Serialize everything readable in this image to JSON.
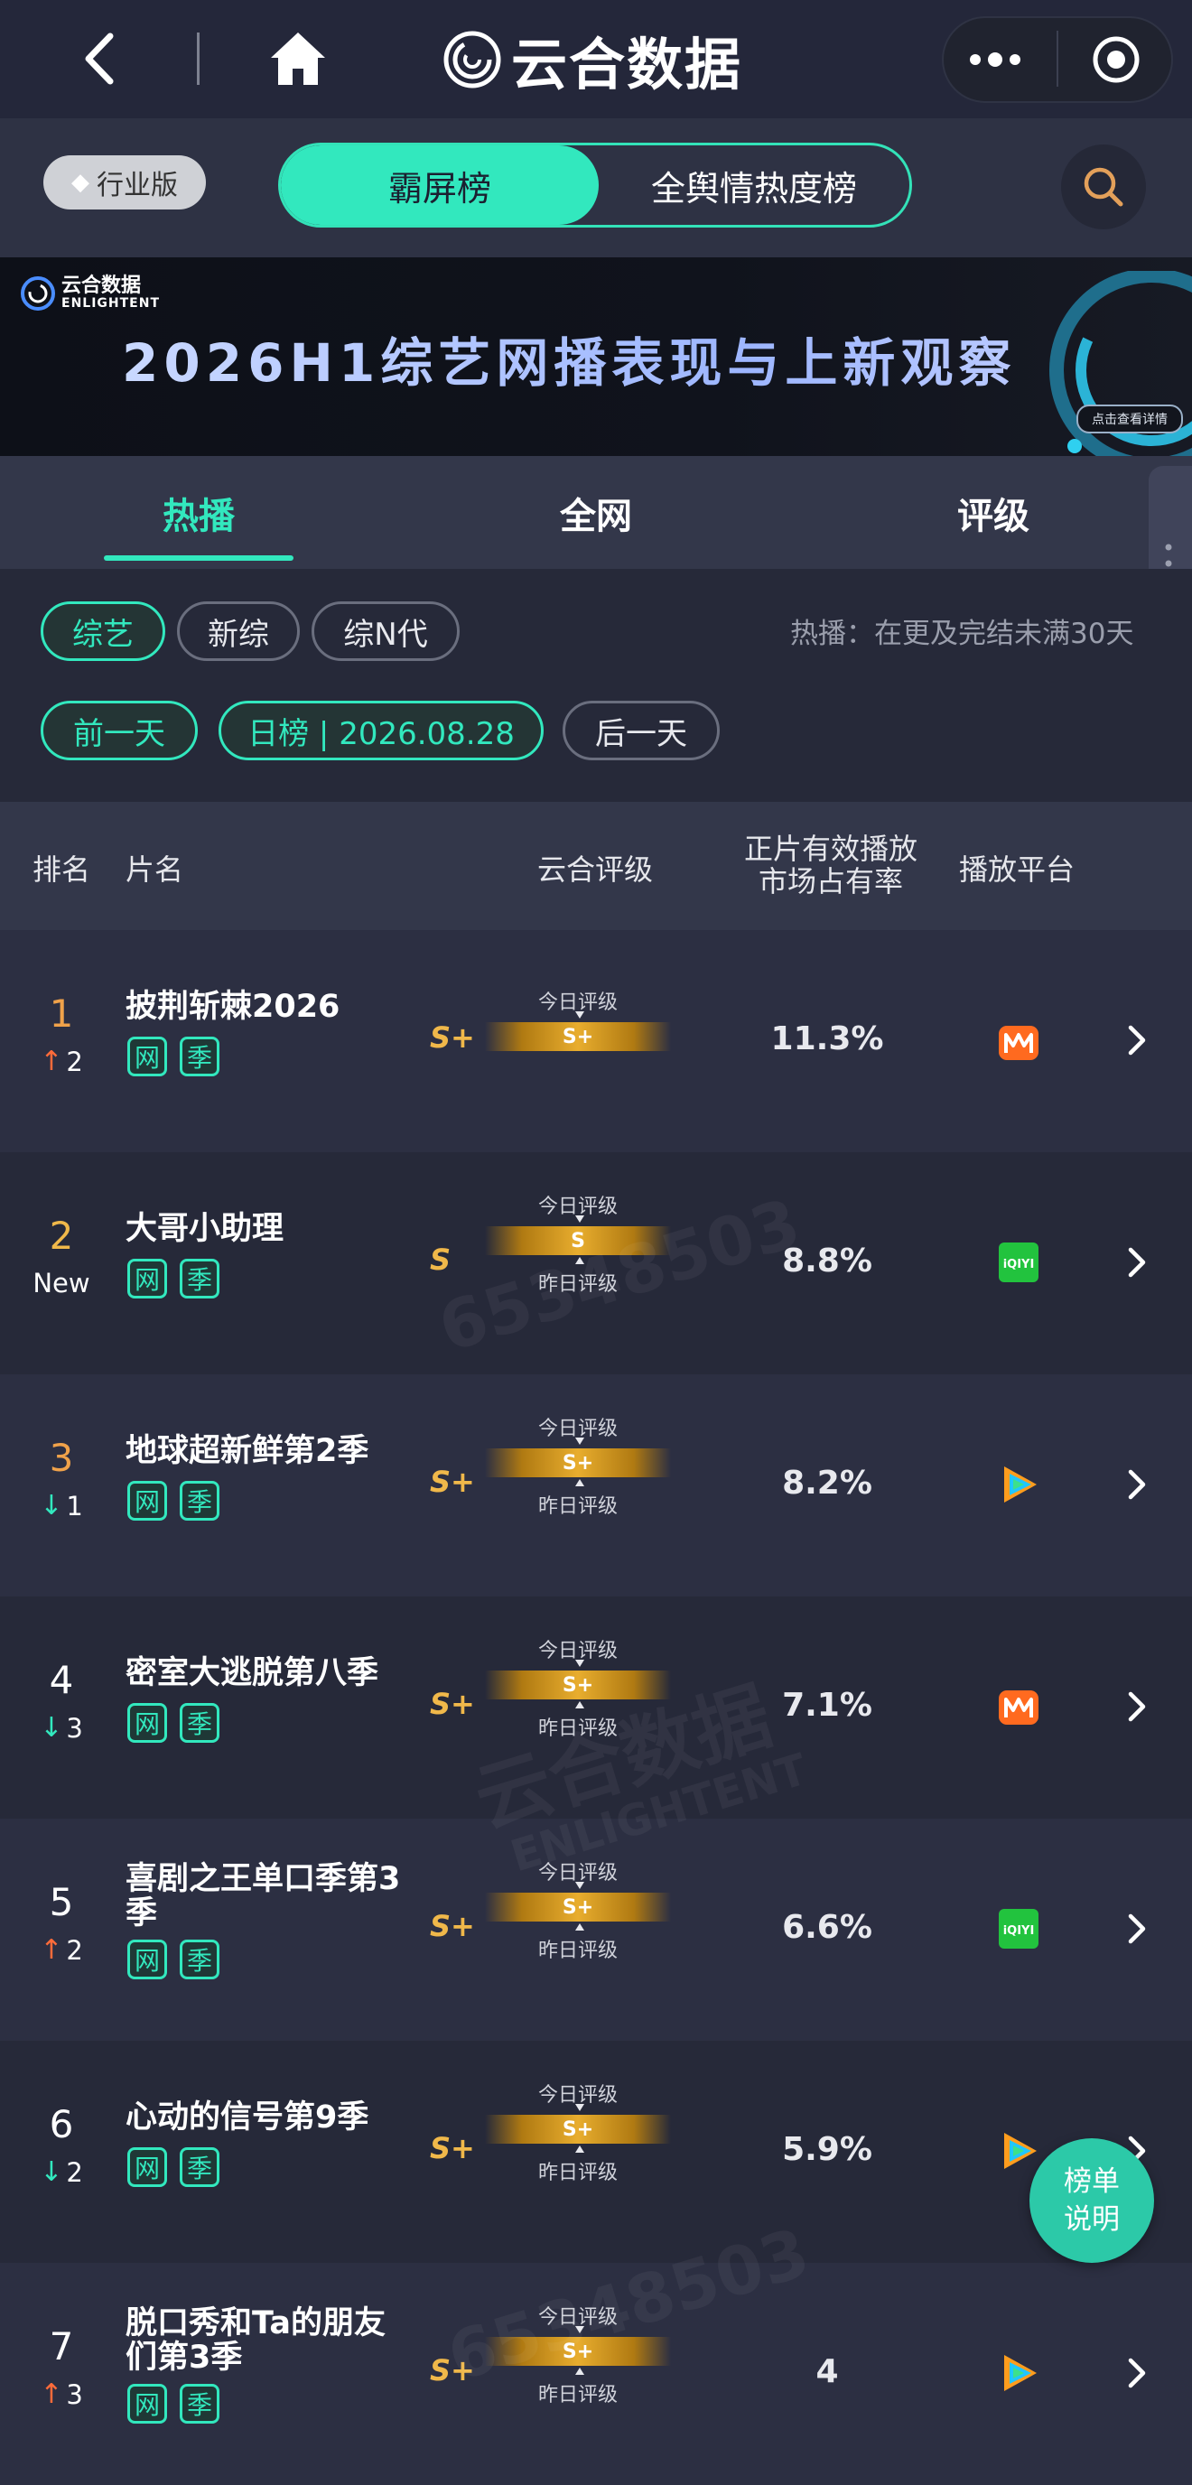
{
  "nav": {
    "app_title": "云合数据",
    "icons": {
      "back": "chevron-left-icon",
      "home": "home-icon",
      "more": "more-dots-icon",
      "close": "target-close-icon",
      "search": "search-icon"
    }
  },
  "segment": {
    "industry_badge": "行业版",
    "options": [
      "霸屏榜",
      "全舆情热度榜"
    ],
    "active_index": 0
  },
  "banner": {
    "brand_cn": "云合数据",
    "brand_en": "ENLIGHTENT",
    "title": "2026H1综艺网播表现与上新观察",
    "cta": "点击查看详情"
  },
  "tabs": [
    "热播",
    "全网",
    "评级"
  ],
  "filters": {
    "categories": [
      "综艺",
      "新综",
      "综N代"
    ],
    "active_category": 0,
    "hint": "热播：在更及完结未满30天",
    "prev_day": "前一天",
    "date_label": "日榜 | 2026.08.28",
    "next_day": "后一天"
  },
  "table": {
    "headers": {
      "rank": "排名",
      "name": "片名",
      "grade": "云合评级",
      "share_line1": "正片有效播放",
      "share_line2": "市场占有率",
      "platform": "播放平台"
    },
    "labels": {
      "today_grade": "今日评级",
      "yesterday_grade": "昨日评级",
      "tag_net": "网",
      "tag_season": "季"
    },
    "rows": [
      {
        "rank": "1",
        "change": "2",
        "dir": "up",
        "name": "披荆斩棘2026",
        "grade": "S+",
        "grade_today": "S+",
        "share": "11.3%",
        "platform": "mango",
        "yesterday": false
      },
      {
        "rank": "2",
        "change": "New",
        "dir": "new",
        "name": "大哥小助理",
        "grade": "S",
        "grade_today": "S",
        "share": "8.8%",
        "platform": "iqiyi",
        "yesterday": true
      },
      {
        "rank": "3",
        "change": "1",
        "dir": "down",
        "name": "地球超新鲜第2季",
        "grade": "S+",
        "grade_today": "S+",
        "share": "8.2%",
        "platform": "tencent",
        "yesterday": true
      },
      {
        "rank": "4",
        "change": "3",
        "dir": "down",
        "name": "密室大逃脱第八季",
        "grade": "S+",
        "grade_today": "S+",
        "share": "7.1%",
        "platform": "mango",
        "yesterday": true
      },
      {
        "rank": "5",
        "change": "2",
        "dir": "up",
        "name": "喜剧之王单口季第3季",
        "grade": "S+",
        "grade_today": "S+",
        "share": "6.6%",
        "platform": "iqiyi",
        "yesterday": true
      },
      {
        "rank": "6",
        "change": "2",
        "dir": "down",
        "name": "心动的信号第9季",
        "grade": "S+",
        "grade_today": "S+",
        "share": "5.9%",
        "platform": "tencent",
        "yesterday": true
      },
      {
        "rank": "7",
        "change": "3",
        "dir": "up",
        "name": "脱口秀和Ta的朋友们第3季",
        "grade": "S+",
        "grade_today": "S+",
        "share": "4",
        "platform": "tencent",
        "yesterday": true
      }
    ]
  },
  "help_button": "榜单说明",
  "watermarks": {
    "id": "65348503",
    "brand": "云合数据",
    "brand_en": "ENLIGHTENT"
  },
  "colors": {
    "accent": "#32e8be",
    "up": "#ff6b3a",
    "down": "#32e8be",
    "rank_orange": "#f0a24a",
    "grade_gold": "#f0b84a",
    "bg": "#262939",
    "row_alt": "#2c2f42"
  }
}
